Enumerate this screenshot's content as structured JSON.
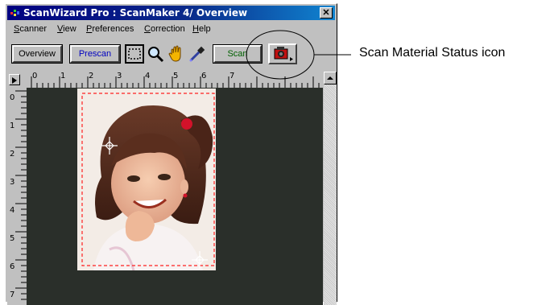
{
  "window": {
    "title": "ScanWizard Pro : ScanMaker 4/ Overview",
    "close_glyph": "✕"
  },
  "menu": {
    "items": [
      {
        "label": "Scanner",
        "underline": "S",
        "rest": "canner"
      },
      {
        "label": "View",
        "underline": "V",
        "rest": "iew"
      },
      {
        "label": "Preferences",
        "underline": "P",
        "rest": "references"
      },
      {
        "label": "Correction",
        "underline": "C",
        "rest": "orrection"
      },
      {
        "label": "Help",
        "underline": "H",
        "rest": "elp"
      }
    ]
  },
  "toolbar": {
    "overview_label": "Overview",
    "prescan_label": "Prescan",
    "scan_label": "Scan",
    "tools": [
      "selection-frame-icon",
      "magnifier-icon",
      "hand-icon",
      "eyedropper-icon"
    ],
    "status_icon": "scan-material-status-icon"
  },
  "ruler": {
    "horizontal": [
      "0",
      "1",
      "2",
      "3",
      "4",
      "5",
      "6",
      "7"
    ],
    "vertical": [
      "0",
      "1",
      "2",
      "3",
      "4",
      "5",
      "6",
      "7"
    ]
  },
  "callout": {
    "label": "Scan Material Status icon"
  },
  "colors": {
    "title_bar": "#000080",
    "preview_background": "#2a2f2a",
    "selection_frame": "#ff2020",
    "prescan_text": "#0000c0"
  }
}
